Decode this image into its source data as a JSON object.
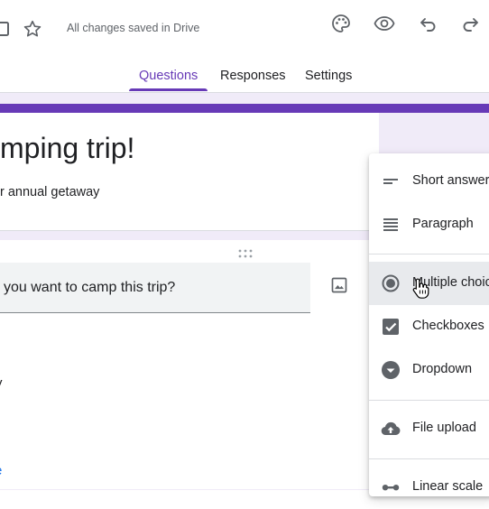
{
  "header": {
    "save_status": "All changes saved in Drive",
    "icons": [
      "folder-icon",
      "star-icon",
      "palette-icon",
      "preview-eye-icon",
      "undo-icon",
      "redo-icon"
    ]
  },
  "tabs": [
    {
      "label": "Questions",
      "active": true
    },
    {
      "label": "Responses",
      "active": false
    },
    {
      "label": "Settings",
      "active": false
    }
  ],
  "form": {
    "title": "mping trip!",
    "description": "r annual getaway"
  },
  "question": {
    "text": "you want to camp this trip?",
    "fragments": [
      "y",
      "e"
    ]
  },
  "type_menu": {
    "items": [
      {
        "label": "Short answer",
        "icon": "short-answer-icon"
      },
      {
        "label": "Paragraph",
        "icon": "paragraph-icon"
      },
      {
        "label": "Multiple choice",
        "icon": "radio-button-icon",
        "selected": true
      },
      {
        "label": "Checkboxes",
        "icon": "checkbox-icon"
      },
      {
        "label": "Dropdown",
        "icon": "dropdown-icon"
      },
      {
        "label": "File upload",
        "icon": "cloud-upload-icon"
      },
      {
        "label": "Linear scale",
        "icon": "linear-scale-icon"
      }
    ]
  },
  "colors": {
    "accent": "#673ab7",
    "background": "#f0ebf8",
    "icon": "#5f6368"
  }
}
